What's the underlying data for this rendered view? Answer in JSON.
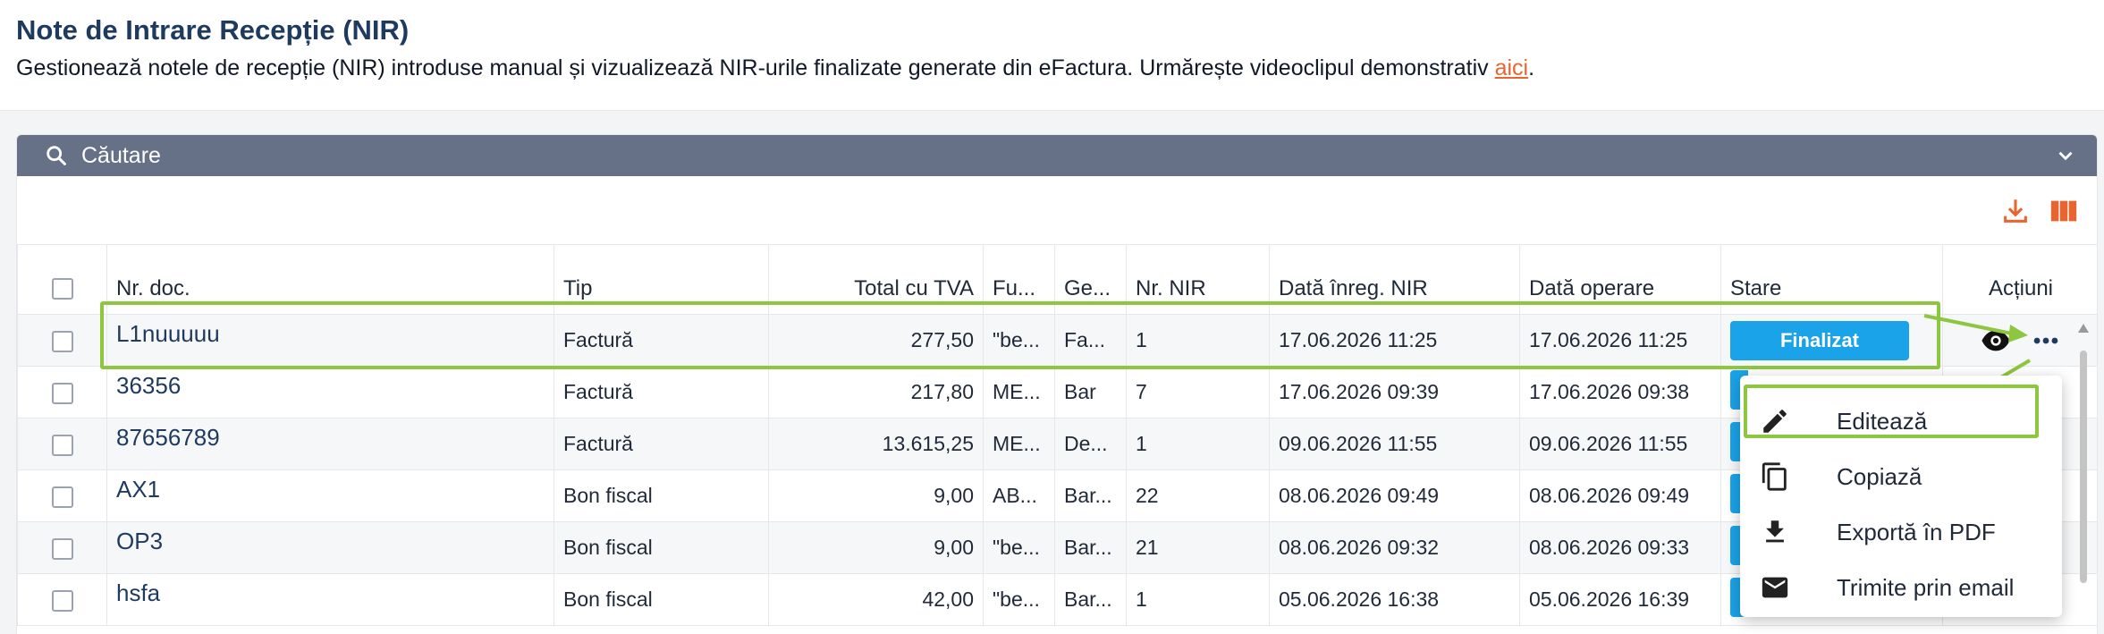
{
  "header": {
    "title": "Note de Intrare Recepție (NIR)",
    "description": "Gestionează notele de recepție (NIR) introduse manual și vizualizează NIR-urile finalizate generate din eFactura. Urmărește videoclipul demonstrativ ",
    "link_text": "aici",
    "description_end": "."
  },
  "search": {
    "label": "Căutare"
  },
  "table": {
    "columns": [
      "Nr. doc.",
      "Tip",
      "Total cu TVA",
      "Fu...",
      "Ge...",
      "Nr. NIR",
      "Dată înreg. NIR",
      "Dată operare",
      "Stare",
      "Acțiuni"
    ],
    "rows": [
      {
        "doc": "L1nuuuuu",
        "tip": "Factură",
        "total": "277,50",
        "fu": "\"be...",
        "ge": "Fa...",
        "nir": "1",
        "inreg": "17.06.2026 11:25",
        "operare": "17.06.2026 11:25",
        "stare": "Finalizat"
      },
      {
        "doc": "36356",
        "tip": "Factură",
        "total": "217,80",
        "fu": "ME...",
        "ge": "Bar",
        "nir": "7",
        "inreg": "17.06.2026 09:39",
        "operare": "17.06.2026 09:38",
        "stare": ""
      },
      {
        "doc": "87656789",
        "tip": "Factură",
        "total": "13.615,25",
        "fu": "ME...",
        "ge": "De...",
        "nir": "1",
        "inreg": "09.06.2026 11:55",
        "operare": "09.06.2026 11:55",
        "stare": ""
      },
      {
        "doc": "AX1",
        "tip": "Bon fiscal",
        "total": "9,00",
        "fu": "AB...",
        "ge": "Bar...",
        "nir": "22",
        "inreg": "08.06.2026 09:49",
        "operare": "08.06.2026 09:49",
        "stare": ""
      },
      {
        "doc": "OP3",
        "tip": "Bon fiscal",
        "total": "9,00",
        "fu": "\"be...",
        "ge": "Bar...",
        "nir": "21",
        "inreg": "08.06.2026 09:32",
        "operare": "08.06.2026 09:33",
        "stare": ""
      },
      {
        "doc": "hsfa",
        "tip": "Bon fiscal",
        "total": "42,00",
        "fu": "\"be...",
        "ge": "Bar...",
        "nir": "1",
        "inreg": "05.06.2026 16:38",
        "operare": "05.06.2026 16:39",
        "stare": ""
      }
    ]
  },
  "menu": {
    "items": [
      "Editează",
      "Copiază",
      "Exportă în PDF",
      "Trimite prin email"
    ]
  },
  "colors": {
    "accent": "#e8652f",
    "status": "#1aa3e8",
    "highlight": "#8dc63f",
    "searchbar": "#667087"
  }
}
